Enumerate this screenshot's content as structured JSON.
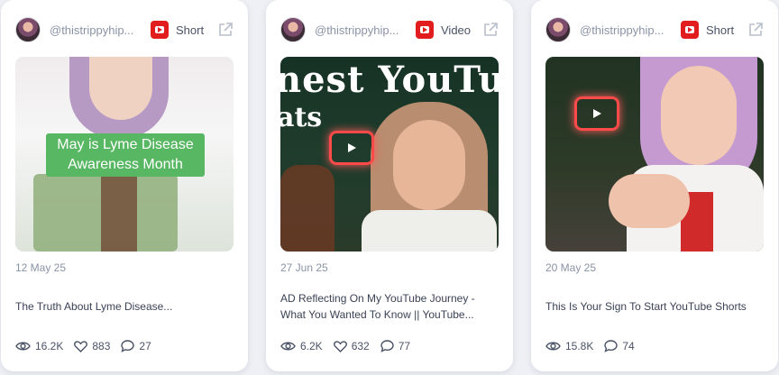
{
  "cards": [
    {
      "handle": "@thistrippyhip...",
      "type": "Short",
      "thumb_caption": "May is Lyme Disease Awareness Month",
      "date": "12 May 25",
      "title": "The Truth About Lyme Disease...",
      "views": "16.2K",
      "likes": "883",
      "comments": "27"
    },
    {
      "handle": "@thistrippyhip...",
      "type": "Video",
      "thumb_overlay_line1": "nest YouTu",
      "thumb_overlay_line2": "ats",
      "date": "27 Jun 25",
      "title": "AD Reflecting On My YouTube Journey - What You Wanted To Know || YouTube...",
      "views": "6.2K",
      "likes": "632",
      "comments": "77"
    },
    {
      "handle": "@thistrippyhip...",
      "type": "Short",
      "date": "20 May 25",
      "title": "This Is Your Sign To Start YouTube Shorts",
      "views": "15.8K",
      "comments": "74"
    }
  ],
  "colors": {
    "youtube_red": "#e11d1d",
    "caption_green": "#58b763",
    "neon_red": "#ff4a4a"
  },
  "icons": [
    "avatar",
    "youtube-logo-icon",
    "external-link-icon",
    "eye-icon",
    "heart-icon",
    "comment-icon",
    "play-icon"
  ]
}
